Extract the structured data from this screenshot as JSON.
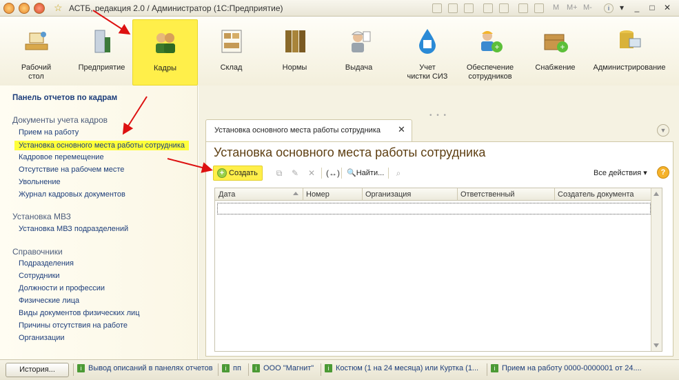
{
  "window": {
    "title": "АСТБ, редакция 2.0 / Администратор  (1С:Предприятие)"
  },
  "title_controls": {
    "m1": "M",
    "m2": "M+",
    "m3": "M-",
    "help": "i"
  },
  "sections": [
    {
      "label": "Рабочий\nстол",
      "icon": "desk-icon"
    },
    {
      "label": "Предприятие",
      "icon": "building-icon"
    },
    {
      "label": "Кадры",
      "icon": "people-icon"
    },
    {
      "label": "Склад",
      "icon": "shelves-icon"
    },
    {
      "label": "Нормы",
      "icon": "binders-icon"
    },
    {
      "label": "Выдача",
      "icon": "worker-icon"
    },
    {
      "label": "Учет\nчистки СИЗ",
      "icon": "drop-icon"
    },
    {
      "label": "Обеспечение\nсотрудников",
      "icon": "employee-add-icon"
    },
    {
      "label": "Снабжение",
      "icon": "box-add-icon"
    },
    {
      "label": "Администрирование",
      "icon": "admin-icon"
    }
  ],
  "left_panel": {
    "title": "Панель отчетов по кадрам",
    "groups": [
      {
        "label": "Документы учета кадров",
        "items": [
          "Прием на работу",
          "Установка основного места работы сотрудника",
          "Кадровое перемещение",
          "Отсутствие на рабочем месте",
          "Увольнение",
          "Журнал кадровых документов"
        ]
      },
      {
        "label": "Установка МВЗ",
        "items": [
          "Установка МВЗ подразделений"
        ]
      },
      {
        "label": "Справочники",
        "items": [
          "Подразделения",
          "Сотрудники",
          "Должности и профессии",
          "Физические лица",
          "Виды документов физических лиц",
          "Причины отсутствия на работе",
          "Организации"
        ]
      }
    ]
  },
  "tab": {
    "label": "Установка основного места работы сотрудника",
    "close": "✕"
  },
  "form": {
    "title": "Установка основного места работы сотрудника",
    "create_label": "Создать",
    "find_label": "Найти...",
    "all_actions_label": "Все действия ▾",
    "help_label": "?",
    "columns": [
      "Дата",
      "Номер",
      "Организация",
      "Ответственный",
      "Создатель документа"
    ]
  },
  "statusbar": {
    "history_label": "История...",
    "items": [
      "Вывод описаний в панелях отчетов",
      "пп",
      "ООО \"Магнит\"",
      "Костюм (1 на 24 месяца) или Куртка (1...",
      "Прием на работу 0000-0000001 от 24...."
    ]
  }
}
